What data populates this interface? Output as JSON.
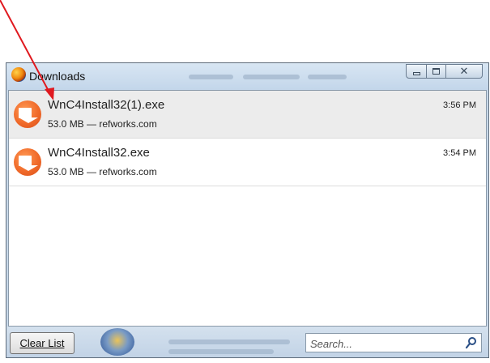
{
  "window": {
    "title": "Downloads"
  },
  "downloads": [
    {
      "filename": "WnC4Install32(1).exe",
      "meta": "53.0 MB — refworks.com",
      "time": "3:56 PM",
      "selected": true
    },
    {
      "filename": "WnC4Install32.exe",
      "meta": "53.0 MB — refworks.com",
      "time": "3:54 PM",
      "selected": false
    }
  ],
  "footer": {
    "clear_label": "Clear List",
    "search_placeholder": "Search..."
  },
  "icons": {
    "app": "firefox-icon",
    "download": "download-icon",
    "search": "search-icon"
  },
  "colors": {
    "annotation_arrow": "#e0191f",
    "download_icon": "#f06a2a"
  }
}
